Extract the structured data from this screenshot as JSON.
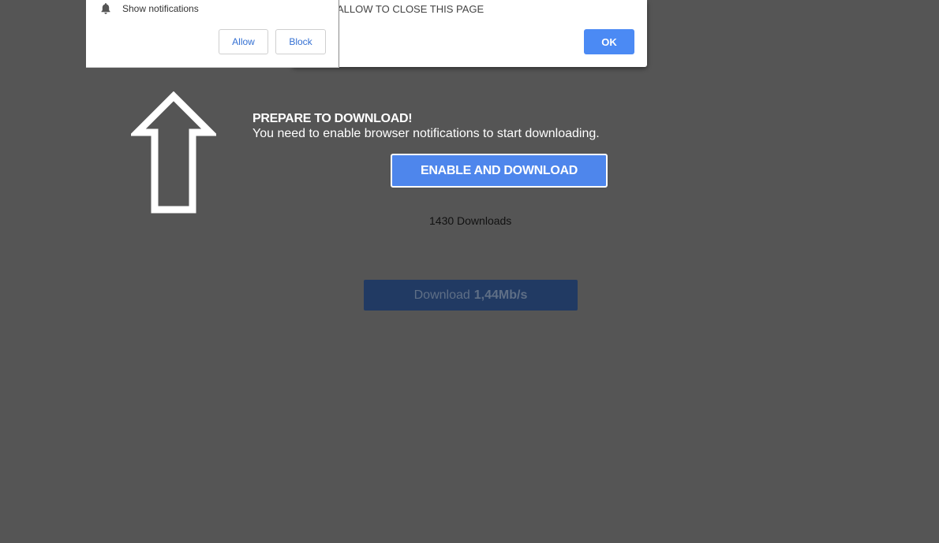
{
  "notification_prompt": {
    "icon": "bell-icon",
    "message": "Show notifications",
    "allow_label": "Allow",
    "block_label": "Block"
  },
  "alert_dialog": {
    "message": "ALLOW TO CLOSE THIS PAGE",
    "ok_label": "OK"
  },
  "main": {
    "title": "PREPARE TO DOWNLOAD!",
    "subtitle": "You need to enable browser notifications to start downloading.",
    "enable_button_label": "ENABLE AND DOWNLOAD",
    "download_count": "1430 Downloads",
    "speed_button_label": "Download",
    "speed_button_value": "1,44Mb/s"
  },
  "colors": {
    "background": "#555555",
    "accent": "#4e86ec",
    "speed_button": "#213a63"
  }
}
